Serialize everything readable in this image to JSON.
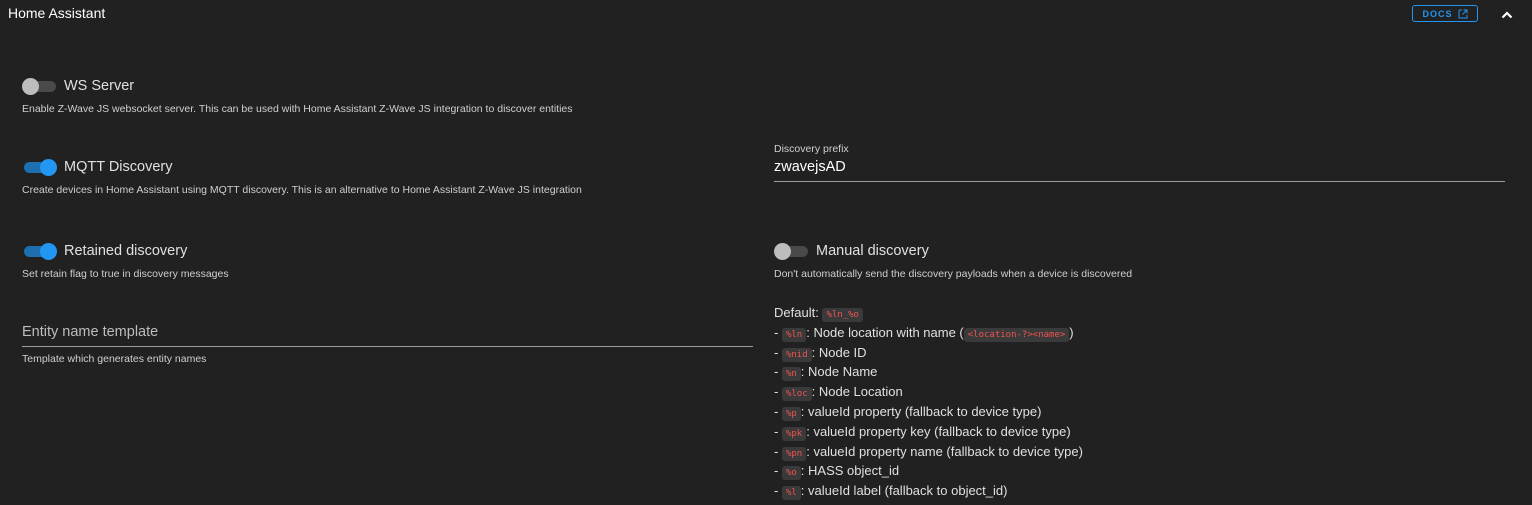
{
  "header": {
    "title": "Home Assistant",
    "docs_label": "DOCS",
    "icons": {
      "docs": "open-in-new-icon",
      "collapse": "chevron-up-icon"
    }
  },
  "colors": {
    "background": "#212121",
    "accent": "#2196f3",
    "code_text": "#ef5350"
  },
  "ws_server": {
    "label": "WS Server",
    "enabled": false,
    "hint": "Enable Z-Wave JS websocket server. This can be used with Home Assistant Z-Wave JS integration to discover entities"
  },
  "mqtt_discovery": {
    "label": "MQTT Discovery",
    "enabled": true,
    "hint": "Create devices in Home Assistant using MQTT discovery. This is an alternative to Home Assistant Z-Wave JS integration"
  },
  "discovery_prefix": {
    "label": "Discovery prefix",
    "value": "zwavejsAD"
  },
  "retained_discovery": {
    "label": "Retained discovery",
    "enabled": true,
    "hint": "Set retain flag to true in discovery messages"
  },
  "manual_discovery": {
    "label": "Manual discovery",
    "enabled": false,
    "hint": "Don't automatically send the discovery payloads when a device is discovered"
  },
  "entity_name_template": {
    "placeholder": "Entity name template",
    "hint": "Template which generates entity names"
  },
  "template_help": {
    "default_prefix": "Default:",
    "default_code": "%ln_%o",
    "items": [
      {
        "code": "%ln",
        "desc": ": Node location with name (",
        "code2": "<location-?><name>",
        "tail": ")"
      },
      {
        "code": "%nid",
        "desc": ": Node ID"
      },
      {
        "code": "%n",
        "desc": ": Node Name"
      },
      {
        "code": "%loc",
        "desc": ": Node Location"
      },
      {
        "code": "%p",
        "desc": ": valueId property (fallback to device type)"
      },
      {
        "code": "%pk",
        "desc": ": valueId property key (fallback to device type)"
      },
      {
        "code": "%pn",
        "desc": ": valueId property name (fallback to device type)"
      },
      {
        "code": "%o",
        "desc": ": HASS object_id"
      },
      {
        "code": "%l",
        "desc": ": valueId label (fallback to object_id)"
      }
    ]
  }
}
